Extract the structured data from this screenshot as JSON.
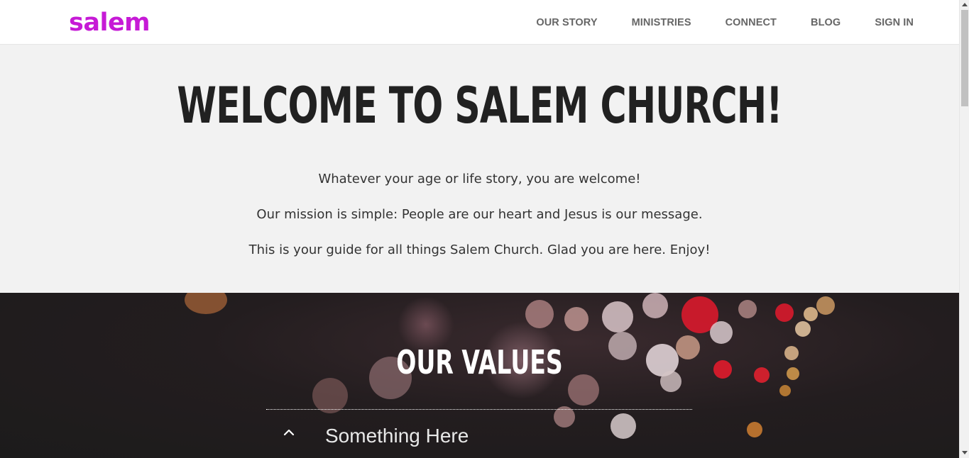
{
  "header": {
    "logo": "salem",
    "nav": [
      {
        "label": "OUR STORY"
      },
      {
        "label": "MINISTRIES"
      },
      {
        "label": "CONNECT"
      },
      {
        "label": "BLOG"
      },
      {
        "label": "SIGN IN"
      }
    ]
  },
  "welcome": {
    "title": "WELCOME TO SALEM CHURCH!",
    "lines": [
      "Whatever your age or life story, you are welcome!",
      "Our mission is simple: People are our heart and Jesus is our message.",
      "This is your guide for all things Salem Church. Glad you are here. Enjoy!"
    ]
  },
  "values": {
    "title": "OUR VALUES",
    "items": [
      {
        "label": "Something Here",
        "icon": "chevron-up-icon",
        "expanded": true
      }
    ]
  },
  "colors": {
    "brand": "#c61ad6",
    "heading": "#212121",
    "section_bg": "#f2f2f2",
    "values_bg": "#1c1b1b"
  }
}
